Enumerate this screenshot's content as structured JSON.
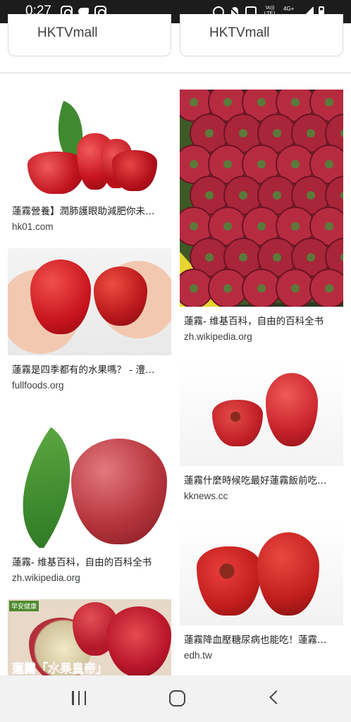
{
  "status_bar": {
    "time": "0:27",
    "left_icons": [
      "instagram-icon",
      "twitter-icon",
      "instagram-icon"
    ],
    "network_labels": {
      "volte_top": "Vo))",
      "volte_bottom": "LTE1",
      "network": "4G+"
    },
    "right_icons": [
      "alarm-icon",
      "mute-icon",
      "recycle-icon",
      "volte-icon",
      "network-icon",
      "signal-icon",
      "battery-icon"
    ]
  },
  "top_cards": [
    {
      "label": "HKTVmall"
    },
    {
      "label": "HKTVmall"
    }
  ],
  "results_left": [
    {
      "caption": "蓮霧營養】潤肺護眼助減肥你未…",
      "source": "hk01.com",
      "image": "wax-apples-on-white"
    },
    {
      "caption": "蓮霧是四季都有的水果嗎？ - 澧…",
      "source": "fullfoods.org",
      "image": "wax-apples-in-hands"
    },
    {
      "caption": "蓮霧- 维基百科，自由的百科全书",
      "source": "zh.wikipedia.org",
      "image": "wax-apple-with-leaf"
    },
    {
      "caption": "",
      "source": "",
      "image": "wax-apple-king-of-fruit",
      "badge": "早安健康",
      "banner": "蓮霧「水果皇帝」"
    }
  ],
  "results_right": [
    {
      "caption": "蓮霧- 维基百科，自由的百科全书",
      "source": "zh.wikipedia.org",
      "image": "wax-apples-in-crate"
    },
    {
      "caption": "蓮霧什麼時候吃最好蓮霧飯前吃…",
      "source": "kknews.cc",
      "image": "two-wax-apples"
    },
    {
      "caption": "蓮霧降血壓糖尿病也能吃！蓮霧…",
      "source": "edh.tw",
      "image": "two-wax-apples-upright"
    }
  ],
  "nav_bar": {
    "icons": [
      "recents-icon",
      "home-icon",
      "back-icon"
    ]
  },
  "colors": {
    "status_bar": "#1c1c1c",
    "nav_bar": "#f2f2f2",
    "fruit_red": "#c91f2a",
    "text": "#202124"
  }
}
